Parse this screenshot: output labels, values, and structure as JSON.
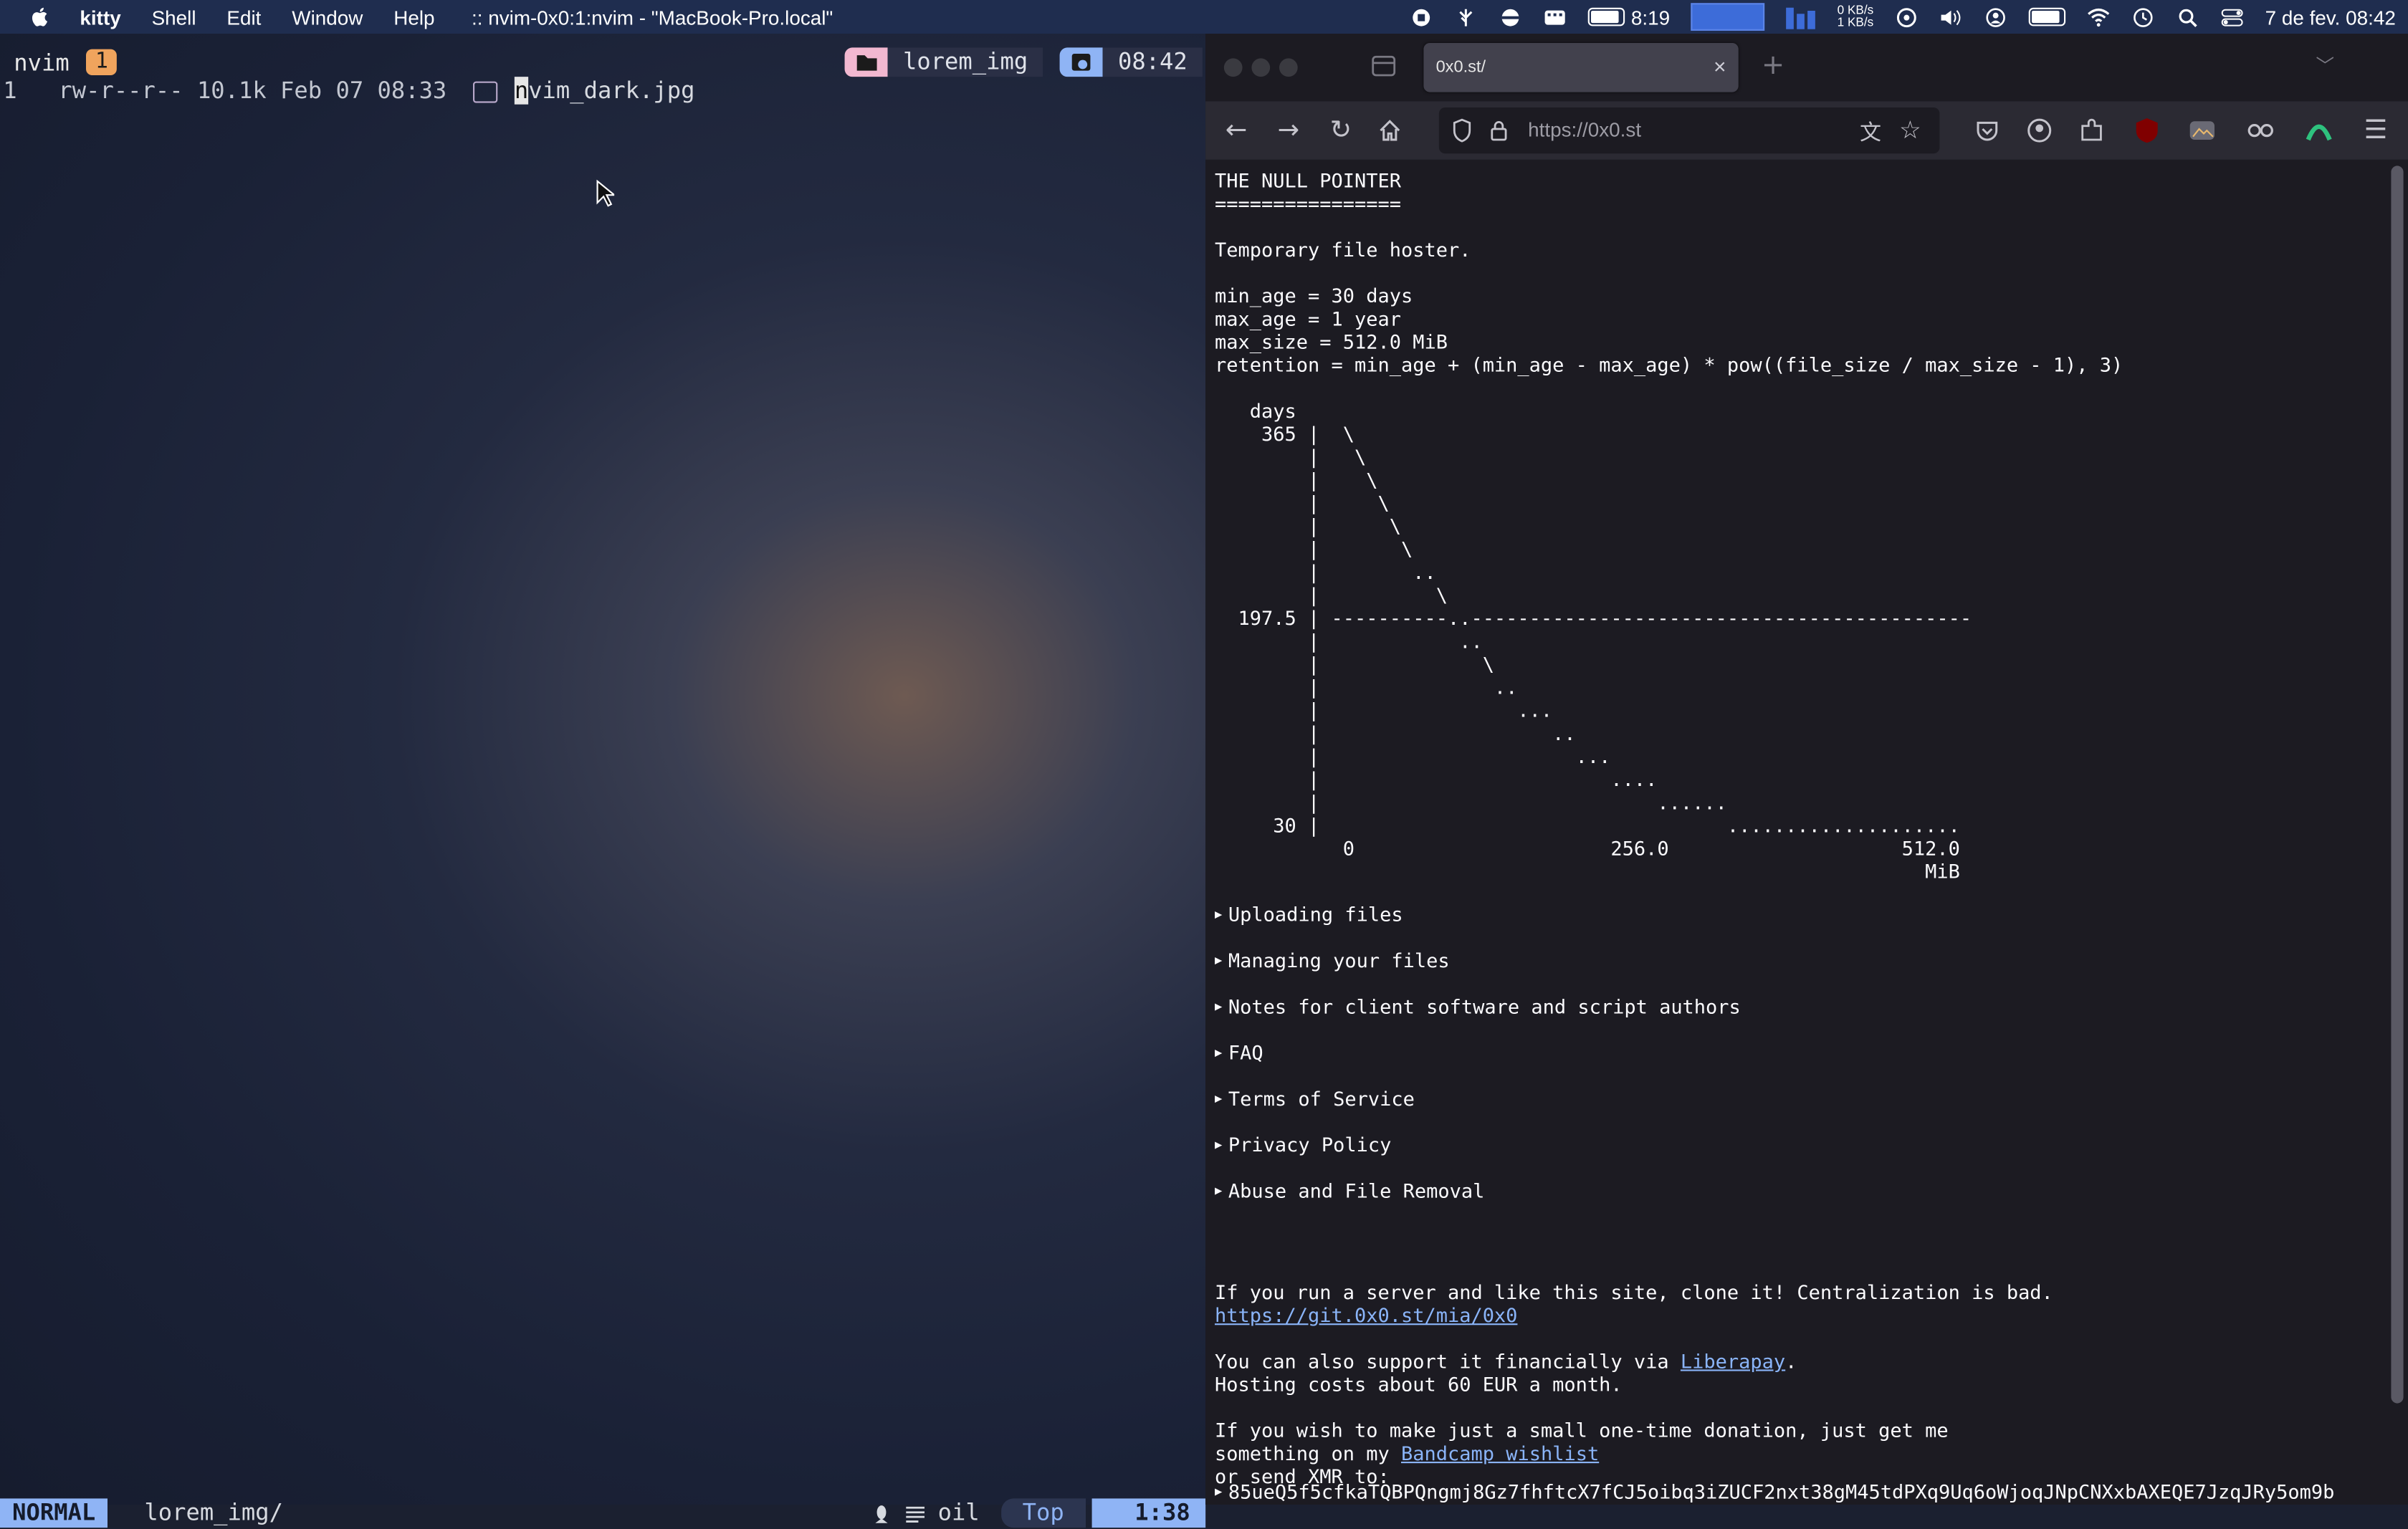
{
  "menubar": {
    "app": "kitty",
    "menus": [
      "Shell",
      "Edit",
      "Window",
      "Help"
    ],
    "window_title": ":: nvim-0x0:1:nvim - \"MacBook-Pro.local\"",
    "battery_time": "8:19",
    "net_up": "0 KB/s",
    "net_down": "1 KB/s",
    "datetime": "7 de fev.  08:42"
  },
  "nvim": {
    "tab_name": "nvim",
    "tab_number": "1",
    "folder": "lorem_img",
    "clock": "08:42",
    "line_number": "1",
    "file_meta": "rw-r--r-- 10.1k Feb 07 08:33",
    "file_first_char": "n",
    "file_rest": "vim_dark.jpg",
    "mode": "NORMAL",
    "cwd": "lorem_img/",
    "filetype": "oil",
    "scroll": "Top",
    "position": "1:38"
  },
  "browser": {
    "tab_title": "0x0.st/",
    "url": "https://0x0.st",
    "page_text": "THE NULL POINTER\n================\n\nTemporary file hoster.\n\nmin_age = 30 days\nmax_age = 1 year\nmax_size = 512.0 MiB\nretention = min_age + (min_age - max_age) * pow((file_size / max_size - 1), 3)\n\n   days\n    365 |  \\\n        |   \\\n        |    \\\n        |     \\\n        |      \\\n        |       \\\n        |        ..\n        |          \\\n  197.5 | ----------..-------------------------------------------\n        |            ..\n        |              \\\n        |               ..\n        |                 ...\n        |                    ..\n        |                      ...\n        |                         ....\n        |                             ......\n     30 |                                   ....................\n           0                      256.0                    512.0\n                                                             MiB",
    "sections": [
      "Uploading files",
      "Managing your files",
      "Notes for client software and script authors",
      "FAQ",
      "Terms of Service",
      "Privacy Policy",
      "Abuse and File Removal"
    ],
    "footer": {
      "clone_text": "If you run a server and like this site, clone it! Centralization is bad.",
      "git_link": "https://git.0x0.st/mia/0x0",
      "support_prefix": "You can also support it financially via ",
      "liberapay": "Liberapay",
      "support_suffix": ".",
      "hosting": "Hosting costs about 60 EUR a month.",
      "donation_line1": "If you wish to make just a small one-time donation, just get me",
      "donation_prefix": "something on my ",
      "wishlist": "Bandcamp wishlist",
      "xmr_line": "or send XMR to:",
      "xmr_address": "85ueQ5f5cfkaTQBPQngmj8Gz7fhftcX7fCJ5oibq3iZUCF2nxt38gM45tdPXq9Uq6oWjoqJNpCNXxbAXEQE7JzqJRy5om9b"
    }
  }
}
